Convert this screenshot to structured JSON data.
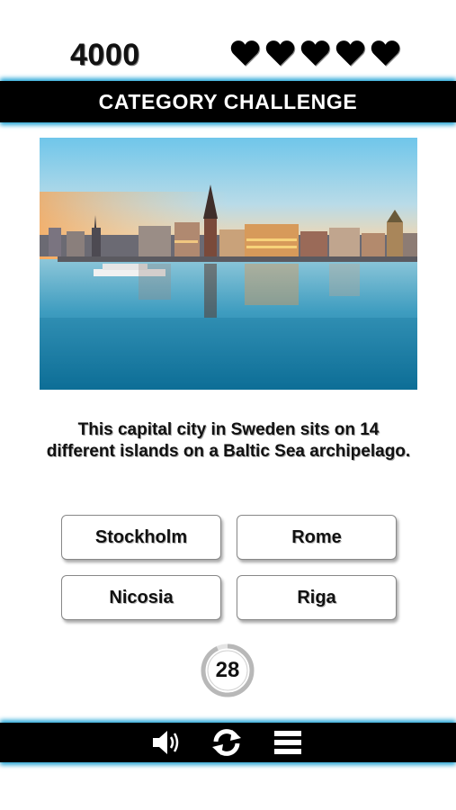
{
  "hud": {
    "score": "4000",
    "lives": 5
  },
  "header": {
    "title": "CATEGORY CHALLENGE"
  },
  "image": {
    "subject": "stockholm-waterfront-photo"
  },
  "question": {
    "text": "This capital city in Sweden sits on 14 different islands on a Baltic Sea archipelago."
  },
  "answers": [
    {
      "label": "Stockholm"
    },
    {
      "label": "Rome"
    },
    {
      "label": "Nicosia"
    },
    {
      "label": "Riga"
    }
  ],
  "timer": {
    "seconds": "28",
    "fraction_remaining": 0.93
  },
  "toolbar": {
    "icons": [
      "speaker-icon",
      "restart-icon",
      "menu-icon"
    ]
  },
  "colors": {
    "bar": "#000000",
    "glow": "#2aa7d6",
    "background": "#ffffff"
  }
}
